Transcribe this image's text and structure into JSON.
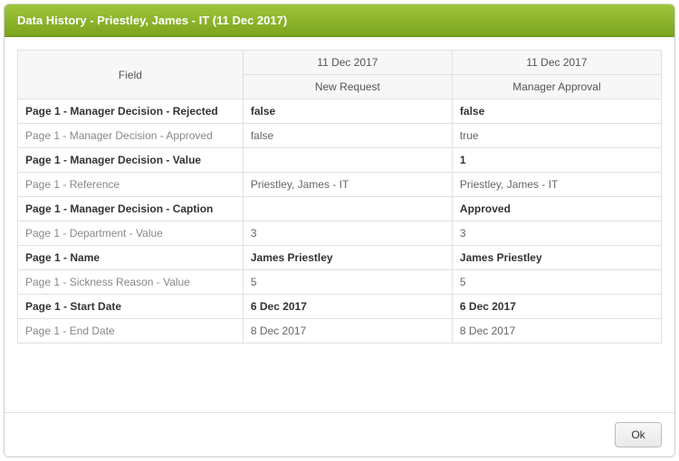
{
  "dialog": {
    "title": "Data History - Priestley, James - IT (11 Dec 2017)"
  },
  "table": {
    "fieldHeader": "Field",
    "columns": [
      {
        "date": "11 Dec 2017",
        "stage": "New Request"
      },
      {
        "date": "11 Dec 2017",
        "stage": "Manager Approval"
      }
    ],
    "rows": [
      {
        "bold": true,
        "field": "Page 1 - Manager Decision - Rejected",
        "v1": "false",
        "v2": "false"
      },
      {
        "bold": false,
        "field": "Page 1 - Manager Decision - Approved",
        "v1": "false",
        "v2": "true"
      },
      {
        "bold": true,
        "field": "Page 1 - Manager Decision - Value",
        "v1": "",
        "v2": "1"
      },
      {
        "bold": false,
        "field": "Page 1 - Reference",
        "v1": "Priestley, James - IT",
        "v2": "Priestley, James - IT"
      },
      {
        "bold": true,
        "field": "Page 1 - Manager Decision - Caption",
        "v1": "",
        "v2": "Approved"
      },
      {
        "bold": false,
        "field": "Page 1 - Department - Value",
        "v1": "3",
        "v2": "3"
      },
      {
        "bold": true,
        "field": "Page 1 - Name",
        "v1": "James Priestley",
        "v2": "James Priestley"
      },
      {
        "bold": false,
        "field": "Page 1 - Sickness Reason - Value",
        "v1": "5",
        "v2": "5"
      },
      {
        "bold": true,
        "field": "Page 1 - Start Date",
        "v1": "6 Dec 2017",
        "v2": "6 Dec 2017"
      },
      {
        "bold": false,
        "field": "Page 1 - End Date",
        "v1": "8 Dec 2017",
        "v2": "8 Dec 2017"
      }
    ]
  },
  "footer": {
    "okLabel": "Ok"
  }
}
